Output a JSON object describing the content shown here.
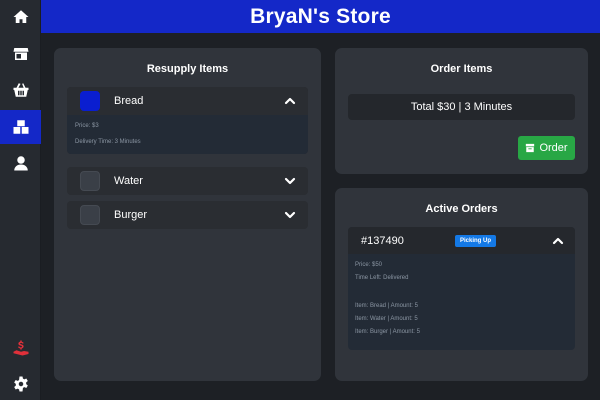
{
  "app": {
    "title": "BryaN's Store"
  },
  "colors": {
    "header": "#1428c8",
    "accent_active": "#1428c8",
    "order_button": "#28a745",
    "badge": "#1479e6",
    "money_icon": "#e0303a",
    "bread_swatch": "#0a1ed0"
  },
  "sidebar": {
    "items": [
      {
        "icon": "home-icon",
        "active": false
      },
      {
        "icon": "store-icon",
        "active": false
      },
      {
        "icon": "basket-icon",
        "active": false
      },
      {
        "icon": "boxes-icon",
        "active": true
      },
      {
        "icon": "user-icon",
        "active": false
      }
    ],
    "bottom": [
      {
        "icon": "hand-money-icon"
      },
      {
        "icon": "gear-icon"
      }
    ]
  },
  "resupply": {
    "title": "Resupply Items",
    "items": [
      {
        "name": "Bread",
        "expanded": true,
        "price": "Price: $3",
        "delivery": "Delivery Time: 3 Minutes"
      },
      {
        "name": "Water",
        "expanded": false
      },
      {
        "name": "Burger",
        "expanded": false
      }
    ]
  },
  "order": {
    "title": "Order Items",
    "total": "Total $30 | 3 Minutes",
    "button_label": "Order"
  },
  "active_orders": {
    "title": "Active Orders",
    "orders": [
      {
        "id": "#137490",
        "status": "Picking Up",
        "price": "Price: $50",
        "time_left": "Time Left: Delivered",
        "lines": [
          "Item: Bread | Amount: 5",
          "Item: Water | Amount: 5",
          "Item: Burger | Amount: 5"
        ]
      }
    ]
  }
}
